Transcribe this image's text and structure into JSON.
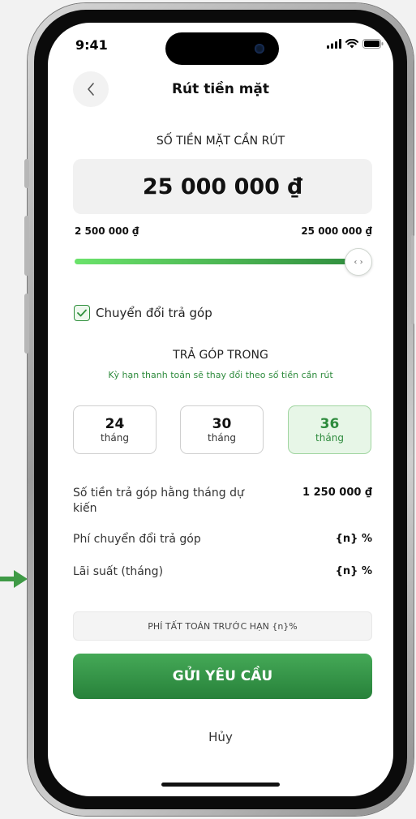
{
  "status_bar": {
    "time": "9:41"
  },
  "header": {
    "title": "Rút tiền mặt"
  },
  "amount": {
    "label": "SỐ TIỀN MẶT CẦN RÚT",
    "value": "25 000 000 ₫",
    "min_label": "2 500 000 ₫",
    "max_label": "25 000 000 ₫",
    "slider_fraction": 1.0
  },
  "installment": {
    "checkbox_label": "Chuyển đổi trả góp",
    "checked": true,
    "section_title": "TRẢ GÓP TRONG",
    "note": "Kỳ hạn thanh toán sẽ thay đổi theo số tiền cần rút",
    "terms": [
      {
        "num": "24",
        "unit": "tháng",
        "selected": false
      },
      {
        "num": "30",
        "unit": "tháng",
        "selected": false
      },
      {
        "num": "36",
        "unit": "tháng",
        "selected": true
      }
    ]
  },
  "details": {
    "monthly_label": "Số tiền trả góp hằng tháng dự kiến",
    "monthly_value": "1 250 000 ₫",
    "fee_label": "Phí chuyển đổi trả góp",
    "fee_value": "{n} %",
    "interest_label": "Lãi suất (tháng)",
    "interest_value": "{n} %"
  },
  "prepay_fee": "PHÍ TẤT TOÁN TRƯỚC HẠN {n}%",
  "actions": {
    "submit": "GỬI YÊU CẦU",
    "cancel": "Hủy"
  },
  "colors": {
    "accent": "#2e8b3d",
    "accent_light": "#e7f6e7",
    "arrow": "#3f9a46"
  },
  "icons": [
    "back-chevron-icon",
    "signal-icon",
    "wifi-icon",
    "battery-icon",
    "slider-arrows-icon",
    "checkmark-icon",
    "right-arrow-icon"
  ]
}
